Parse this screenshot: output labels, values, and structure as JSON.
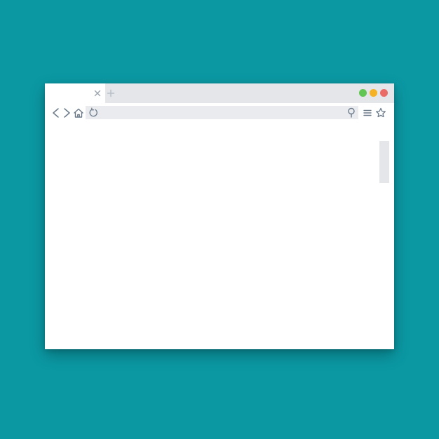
{
  "tab": {
    "title": ""
  },
  "address_bar": {
    "value": "",
    "placeholder": ""
  },
  "colors": {
    "background": "#0b98a3",
    "chrome": "#e4e6e9",
    "icon": "#6b7a8a",
    "maximize": "#62c554",
    "minimize": "#f6b226",
    "close": "#ea6b66"
  },
  "icons": {
    "tab_close": "close-icon",
    "new_tab": "plus-icon",
    "back": "chevron-left-icon",
    "forward": "chevron-right-icon",
    "home": "home-icon",
    "reload": "reload-icon",
    "search": "search-icon",
    "menu": "menu-icon",
    "bookmark": "star-icon"
  }
}
